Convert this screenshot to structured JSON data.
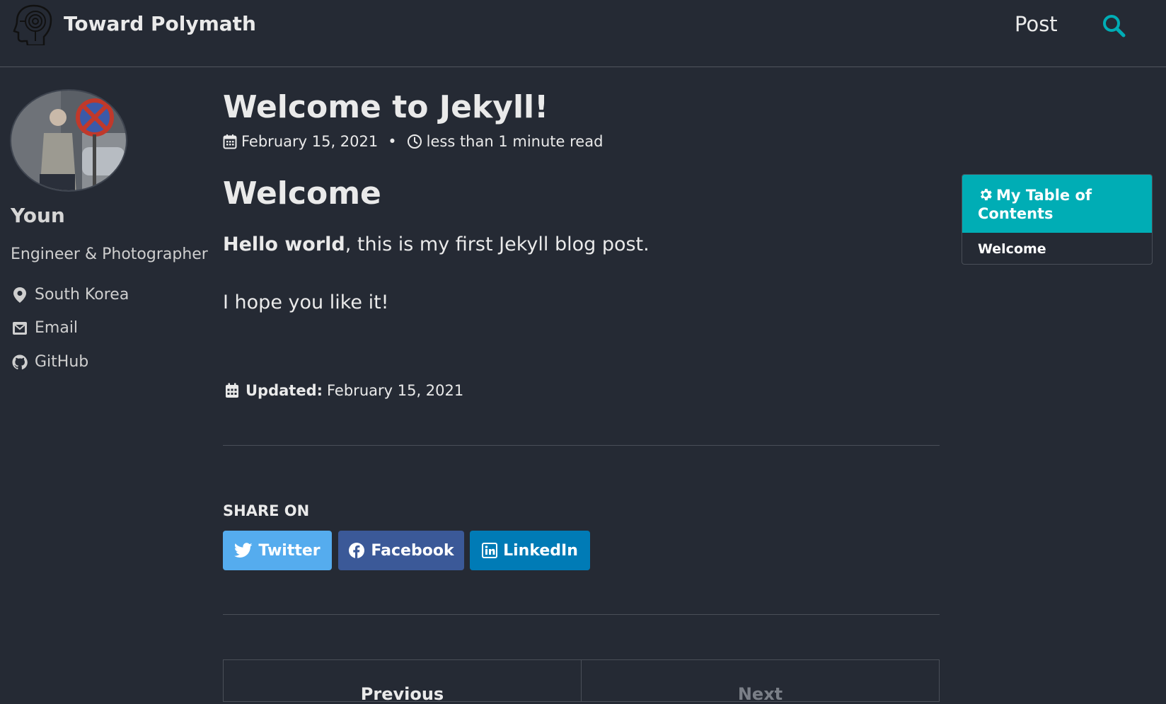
{
  "header": {
    "site_title": "Toward Polymath",
    "nav_post": "Post"
  },
  "sidebar": {
    "name": "Youn",
    "bio": "Engineer & Photographer",
    "location": "South Korea",
    "email": "Email",
    "github": "GitHub"
  },
  "post": {
    "title": "Welcome to Jekyll!",
    "date": "February 15, 2021",
    "meta_separator": "•",
    "read_time": "less than 1 minute read",
    "heading": "Welcome",
    "para1_bold": "Hello world",
    "para1_rest": ", this is my first Jekyll blog post.",
    "para2": "I hope you like it!",
    "updated_label": "Updated:",
    "updated_date": "February 15, 2021"
  },
  "share": {
    "title": "SHARE ON",
    "twitter": "Twitter",
    "facebook": "Facebook",
    "linkedin": "LinkedIn",
    "colors": {
      "twitter": "#55acee",
      "facebook": "#3b5998",
      "linkedin": "#007bb6"
    }
  },
  "pager": {
    "previous": "Previous",
    "next": "Next"
  },
  "toc": {
    "title": "My Table of Contents",
    "items": [
      "Welcome"
    ]
  },
  "colors": {
    "background": "#252a34",
    "accent": "#00adb5",
    "text": "#eaeaea"
  }
}
